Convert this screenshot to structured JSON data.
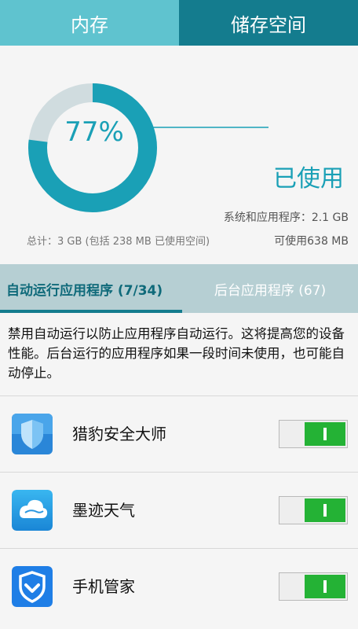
{
  "top_tabs": [
    {
      "label": "内存",
      "active": true
    },
    {
      "label": "储存空间",
      "active": false
    }
  ],
  "usage": {
    "percent_label": "77%",
    "used_fraction": 0.77,
    "used_label": "已使用",
    "system_apps": "系统和应用程序：2.1 GB",
    "available": "可使用638 MB",
    "total": "总计：3 GB (包括 238 MB 已使用空间)"
  },
  "colors": {
    "accent": "#1aa0b6",
    "ring_unused": "#d0dcdf",
    "toggle_on": "#24b235"
  },
  "sub_tabs": [
    {
      "label": "自动运行应用程序 (7/34)",
      "active": true
    },
    {
      "label": "后台应用程序 (67)",
      "active": false
    }
  ],
  "description": "禁用自动运行以防止应用程序自动运行。这将提高您的设备性能。后台运行的应用程序如果一段时间未使用，也可能自动停止。",
  "apps": [
    {
      "name": "猎豹安全大师",
      "icon": "shield-icon",
      "enabled": true
    },
    {
      "name": "墨迹天气",
      "icon": "weather-cloud-icon",
      "enabled": true
    },
    {
      "name": "手机管家",
      "icon": "guard-shield-icon",
      "enabled": true
    }
  ]
}
